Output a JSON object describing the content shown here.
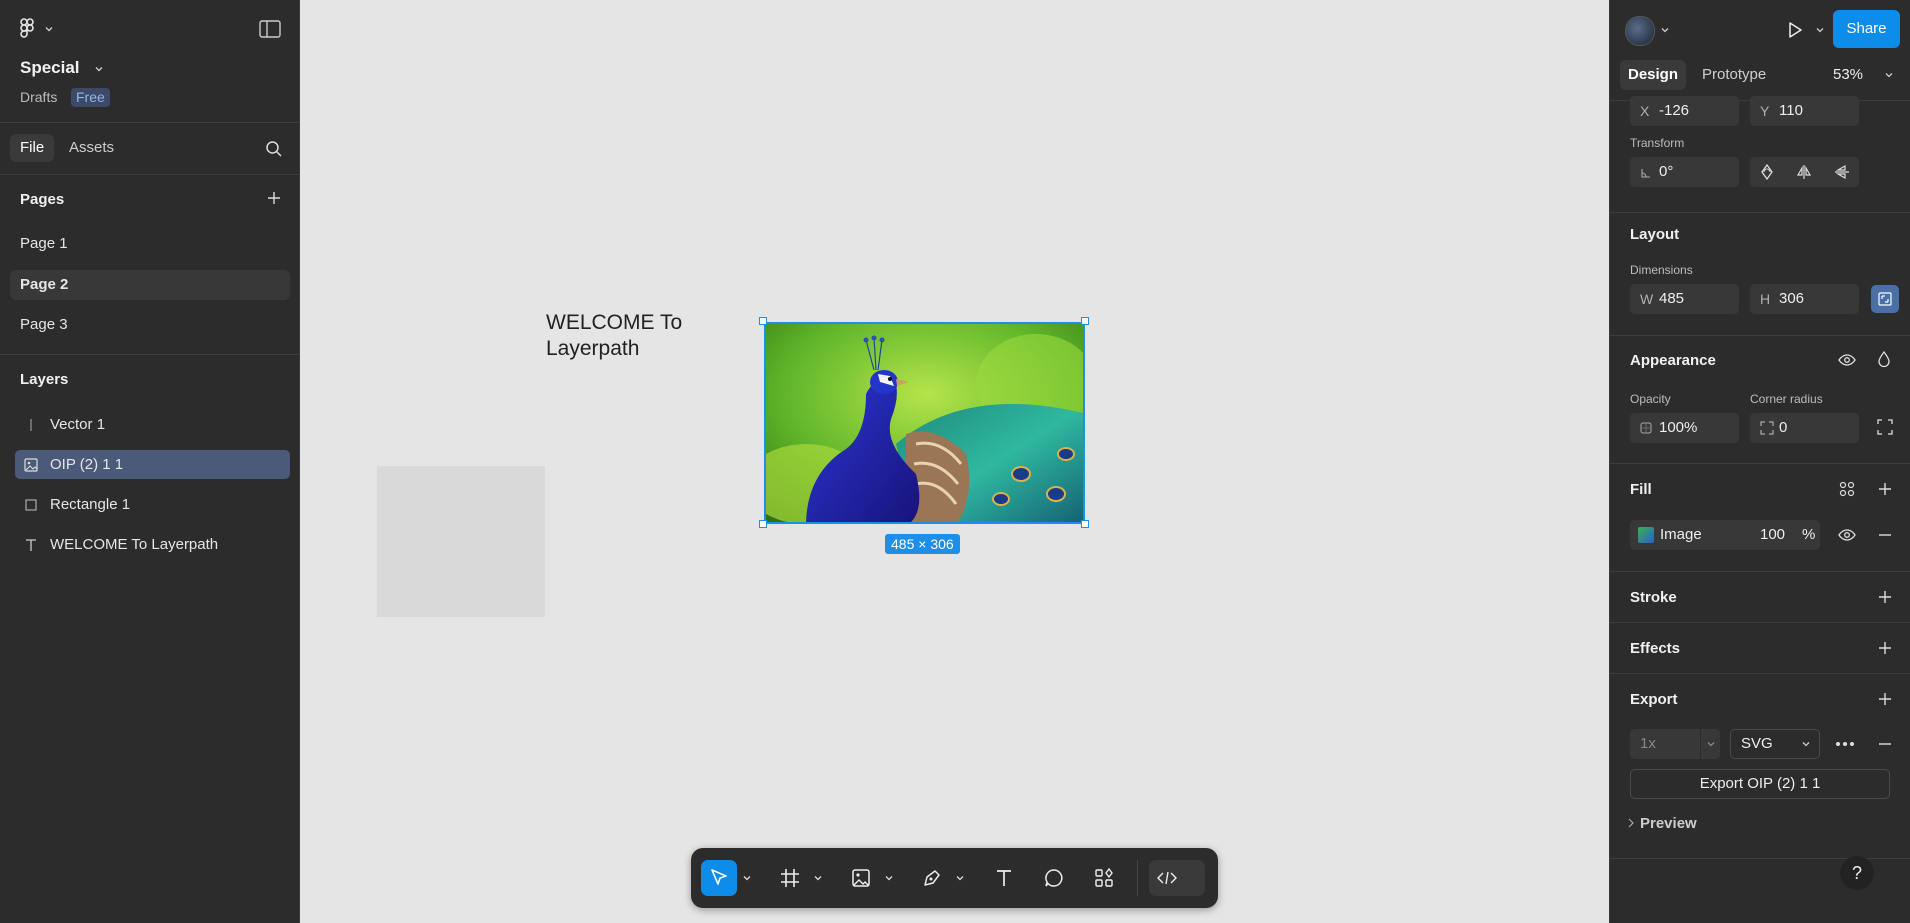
{
  "file": {
    "name": "Special",
    "location": "Drafts",
    "plan": "Free"
  },
  "left_tabs": {
    "file": "File",
    "assets": "Assets"
  },
  "pages": {
    "title": "Pages",
    "items": [
      "Page 1",
      "Page 2",
      "Page 3"
    ],
    "active_index": 1
  },
  "layers": {
    "title": "Layers",
    "items": [
      {
        "label": "Vector 1",
        "icon": "vector-line-icon"
      },
      {
        "label": "OIP (2) 1 1",
        "icon": "image-icon",
        "selected": true
      },
      {
        "label": "Rectangle 1",
        "icon": "rectangle-icon"
      },
      {
        "label": "WELCOME To Layerpath",
        "icon": "text-icon"
      }
    ]
  },
  "canvas": {
    "text_line1": "WELCOME To",
    "text_line2": "Layerpath",
    "selection_badge": "485 × 306",
    "background_color": "#e5e5e5",
    "selection_color": "#1e8fe8"
  },
  "header": {
    "share": "Share",
    "zoom": "53%"
  },
  "right_tabs": {
    "design": "Design",
    "prototype": "Prototype"
  },
  "position": {
    "x_label": "X",
    "x": "-126",
    "y_label": "Y",
    "y": "110"
  },
  "transform": {
    "title": "Transform",
    "rotation": "0°"
  },
  "layout": {
    "title": "Layout",
    "dimensions_label": "Dimensions",
    "w_label": "W",
    "w": "485",
    "h_label": "H",
    "h": "306"
  },
  "appearance": {
    "title": "Appearance",
    "opacity_label": "Opacity",
    "opacity": "100%",
    "radius_label": "Corner radius",
    "radius": "0"
  },
  "fill": {
    "title": "Fill",
    "type": "Image",
    "opacity": "100",
    "unit": "%"
  },
  "stroke": {
    "title": "Stroke"
  },
  "effects": {
    "title": "Effects"
  },
  "export": {
    "title": "Export",
    "scale": "1x",
    "format": "SVG",
    "button": "Export OIP (2) 1 1",
    "preview": "Preview"
  },
  "help": "?"
}
